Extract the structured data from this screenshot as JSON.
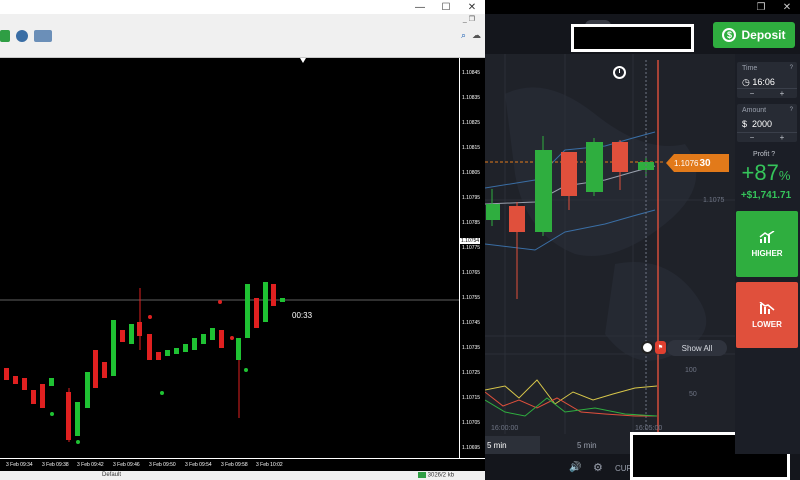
{
  "mt_window": {
    "price_scale": [
      "1.10845",
      "1.10835",
      "1.10825",
      "1.10815",
      "1.10805",
      "1.10795",
      "1.10785",
      "1.10775",
      "1.10765",
      "1.10755",
      "1.10745",
      "1.10735",
      "1.10725",
      "1.10715",
      "1.10705",
      "1.10695"
    ],
    "current_price_tag": "1.10754",
    "countdown": "00:33",
    "time_labels": [
      "3 Feb 09:34",
      "3 Feb 09:38",
      "3 Feb 09:42",
      "3 Feb 09:46",
      "3 Feb 09:50",
      "3 Feb 09:54",
      "3 Feb 09:58",
      "3 Feb 10:02"
    ],
    "status_profile": "Default",
    "status_traffic": "3026/2 kb"
  },
  "app": {
    "deposit_label": "Deposit",
    "time_box": {
      "label": "Time",
      "value": "16:06",
      "minus": "−",
      "plus": "+"
    },
    "amount_box": {
      "label": "Amount",
      "currency": "$",
      "value": "2000",
      "minus": "−",
      "plus": "+"
    },
    "profit": {
      "label": "Profit",
      "percent": "+87",
      "percent_sign": "%",
      "amount": "+$1,741.71"
    },
    "higher_label": "HIGHER",
    "lower_label": "LOWER",
    "price_flag_prefix": "1.1076",
    "price_flag_bold": "30",
    "axis_right_price": "1.1075",
    "show_all_label": "Show All",
    "time_ticks": [
      "16:00:00",
      "16:05:00"
    ],
    "osc_levels": [
      "100",
      "50"
    ],
    "timeframe_1": "5 min",
    "timeframe_2": "5 min",
    "bottom_cur": "CUR",
    "colors": {
      "green": "#2fae3f",
      "red": "#e0503c",
      "orange": "#e27a1a"
    }
  }
}
